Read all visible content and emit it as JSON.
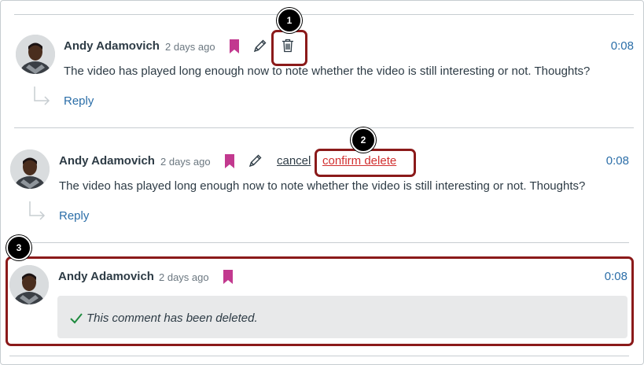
{
  "comments": [
    {
      "author": "Andy Adamovich",
      "ago": "2 days ago",
      "time": "0:08",
      "text": "The video has played long enough now to note whether the video is still interesting or not. Thoughts?",
      "reply_label": "Reply"
    },
    {
      "author": "Andy Adamovich",
      "ago": "2 days ago",
      "time": "0:08",
      "text": "The video has played long enough now to note whether the video is still interesting or not. Thoughts?",
      "reply_label": "Reply",
      "cancel_label": "cancel",
      "confirm_label": "confirm delete"
    },
    {
      "author": "Andy Adamovich",
      "ago": "2 days ago",
      "time": "0:08",
      "deleted_message": "This comment has been deleted."
    }
  ],
  "callouts": [
    "1",
    "2",
    "3"
  ],
  "icons": {
    "bookmark": "bookmark-icon",
    "edit": "pencil-icon",
    "delete": "trash-icon",
    "reply": "reply-arrow-icon",
    "deleted": "check-icon"
  },
  "colors": {
    "link": "#2b6ea8",
    "bookmark": "#c2398f",
    "danger": "#d12f2f",
    "callout": "#8b1a1a",
    "success": "#1e8a3e"
  }
}
